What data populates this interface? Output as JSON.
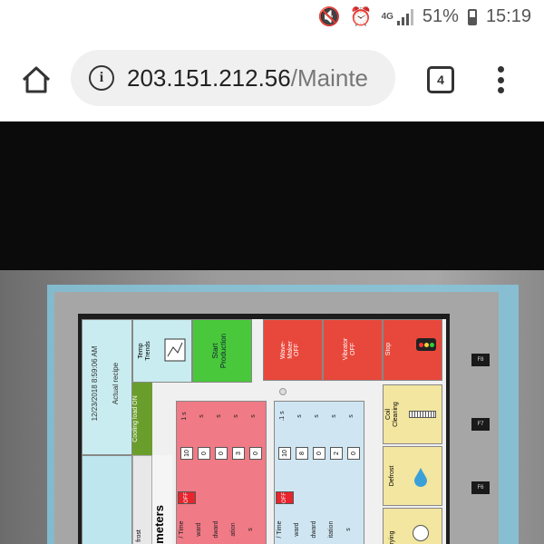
{
  "status_bar": {
    "network": "4G",
    "battery": "51%",
    "time": "15:19",
    "icons": [
      "mute-icon",
      "alarm-icon",
      "signal-icon",
      "battery-icon"
    ]
  },
  "browser": {
    "url_host": "203.151.212.56",
    "url_path": "/Mainte",
    "tab_count": "4"
  },
  "hmi": {
    "datetime": "12/23/2018 8:59:06 AM",
    "actual_recipe": "Actual recipe",
    "temp_trends": "Temp\nTrends",
    "start_production": "Start\nProduction",
    "wave_maker": "Wave-\nMaker\nOFF",
    "vibrator": "Vibrator\nOFF",
    "stop": "Stop",
    "cooling": "Cooling load ON",
    "parameters": "ameters",
    "defrost_left": "frost",
    "coil_cleaning": "Coil\nCleaning",
    "defrost": "Defrost",
    "drying": "rying",
    "off": "OFF",
    "left_labels": [
      "/ Time",
      "ward",
      "dward",
      "ation",
      "s"
    ],
    "left_values": [
      "10",
      "0",
      "0",
      "3",
      "0"
    ],
    "left_units": [
      "1 s",
      "s",
      "s",
      "s",
      "s"
    ],
    "right_labels": [
      "/ Time",
      "ward",
      "dward",
      "itation",
      "s"
    ],
    "right_values": [
      "10",
      "8",
      "0",
      "2",
      "0"
    ],
    "right_units": [
      ".1 s",
      "s",
      "s",
      "s",
      "s"
    ],
    "fkeys": [
      "F8",
      "F7",
      "F6"
    ]
  }
}
